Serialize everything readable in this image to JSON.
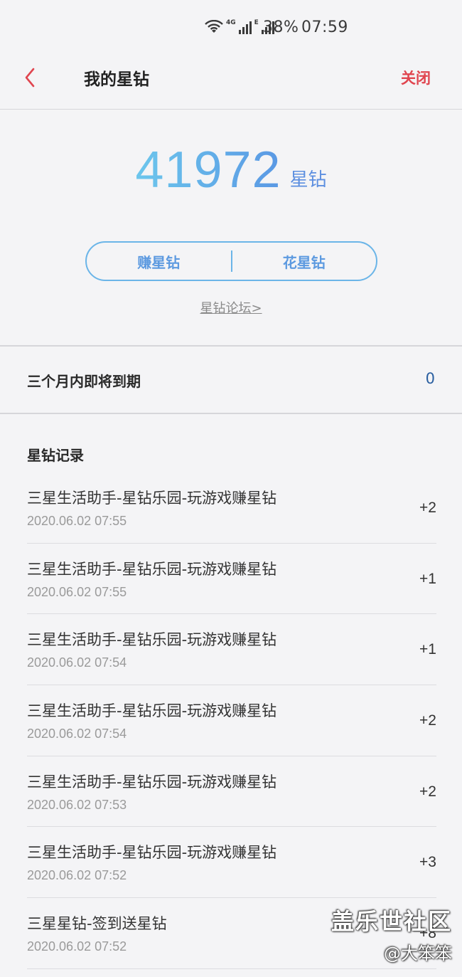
{
  "status_bar": {
    "network_tag_1": "4G",
    "network_tag_2": "E",
    "battery": "38%",
    "time": "07:59"
  },
  "header": {
    "title": "我的星钻",
    "close_label": "关闭"
  },
  "balance": {
    "value": "41972",
    "unit": "星钻"
  },
  "actions": {
    "earn_label": "赚星钻",
    "spend_label": "花星钻",
    "forum_link": "星钻论坛>"
  },
  "expiring": {
    "label": "三个月内即将到期",
    "value": "0"
  },
  "records": {
    "title": "星钻记录",
    "items": [
      {
        "name": "三星生活助手-星钻乐园-玩游戏赚星钻",
        "time": "2020.06.02 07:55",
        "points": "+2"
      },
      {
        "name": "三星生活助手-星钻乐园-玩游戏赚星钻",
        "time": "2020.06.02 07:55",
        "points": "+1"
      },
      {
        "name": "三星生活助手-星钻乐园-玩游戏赚星钻",
        "time": "2020.06.02 07:54",
        "points": "+1"
      },
      {
        "name": "三星生活助手-星钻乐园-玩游戏赚星钻",
        "time": "2020.06.02 07:54",
        "points": "+2"
      },
      {
        "name": "三星生活助手-星钻乐园-玩游戏赚星钻",
        "time": "2020.06.02 07:53",
        "points": "+2"
      },
      {
        "name": "三星生活助手-星钻乐园-玩游戏赚星钻",
        "time": "2020.06.02 07:52",
        "points": "+3"
      },
      {
        "name": "三星星钻-签到送星钻",
        "time": "2020.06.02 07:52",
        "points": "+8"
      }
    ]
  },
  "watermark": {
    "line1": "盖乐世社区",
    "line2": "@大笨笨"
  },
  "colors": {
    "accent_red": "#e0454f",
    "accent_blue": "#5d9ae0",
    "gradient_start": "#6cc6ec",
    "gradient_end": "#5a98e4"
  },
  "icons": {
    "back": "chevron-left-icon",
    "wifi": "wifi-icon",
    "signal": "signal-icon"
  }
}
